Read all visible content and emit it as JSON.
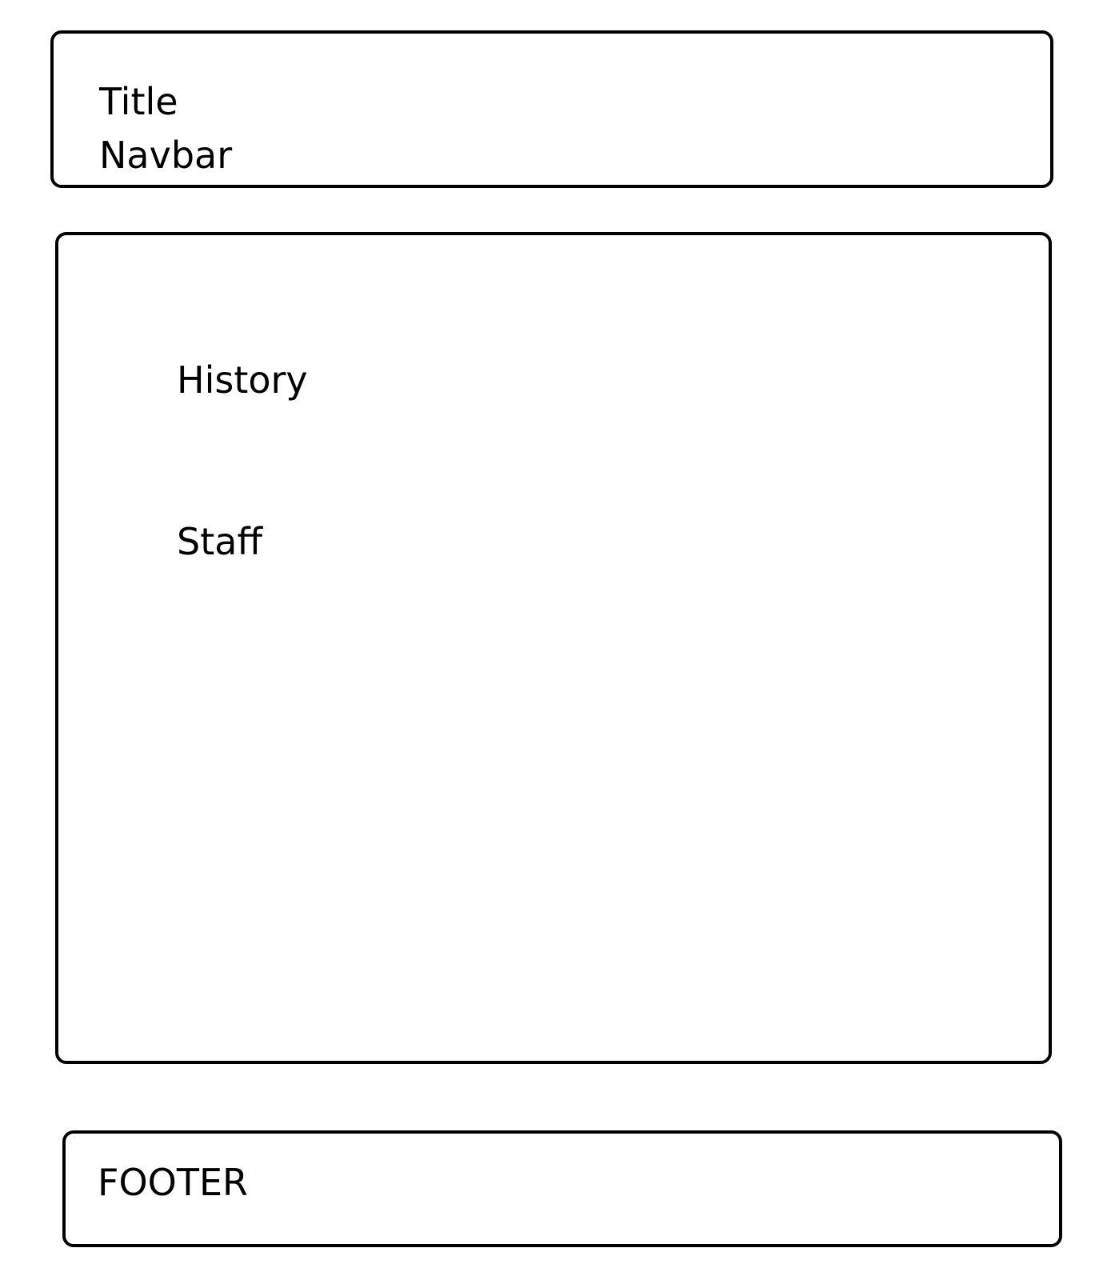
{
  "header": {
    "title": "Title",
    "navbar": "Navbar"
  },
  "main": {
    "sections": [
      "History",
      "Staff"
    ]
  },
  "footer": {
    "label": "FOOTER"
  }
}
